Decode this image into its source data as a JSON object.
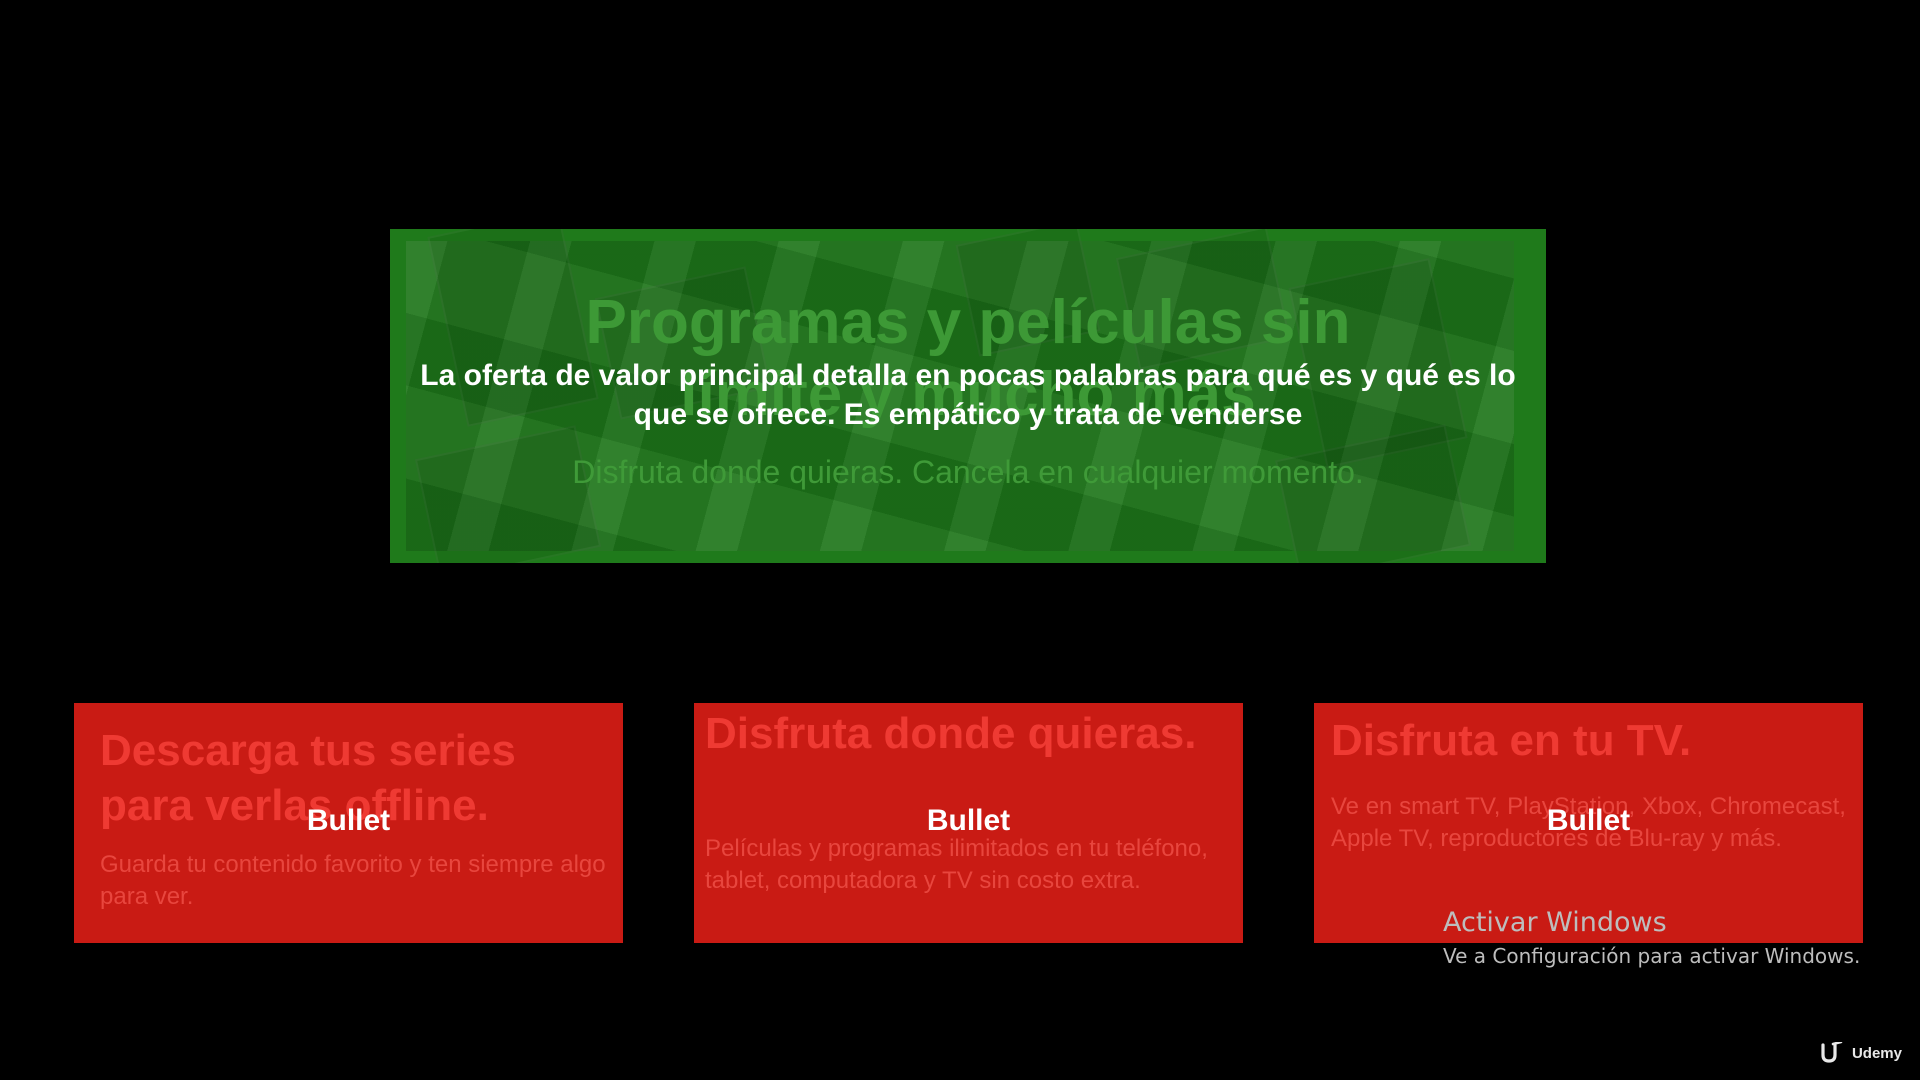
{
  "hero": {
    "title": "Programas y películas sin\nlímite y mucho más",
    "subtitle": "Disfruta donde quieras. Cancela en cualquier momento.",
    "overlay": "La oferta de valor principal detalla en pocas palabras para qué es y qué es lo que se ofrece. Es empático y trata de venderse",
    "color": "#1f7a1b"
  },
  "cards": [
    {
      "title": "Descarga tus series para verlas offline.",
      "description": "Guarda tu contenido favorito y ten siempre algo para ver.",
      "overlay": "Bullet"
    },
    {
      "title": "Disfruta donde quieras.",
      "description": "Películas y programas ilimitados en tu teléfono, tablet, computadora y TV sin costo extra.",
      "overlay": "Bullet"
    },
    {
      "title": "Disfruta en tu TV.",
      "description": "Ve en smart TV, PlayStation, Xbox, Chromecast, Apple TV, reproductores de Blu-ray y más.",
      "overlay": "Bullet"
    }
  ],
  "card_color": "#c91b14",
  "watermark": {
    "title": "Activar Windows",
    "subtitle": "Ve a Configuración para activar Windows."
  },
  "brand": {
    "name": "Udemy",
    "icon": "udemy-logo-icon"
  }
}
